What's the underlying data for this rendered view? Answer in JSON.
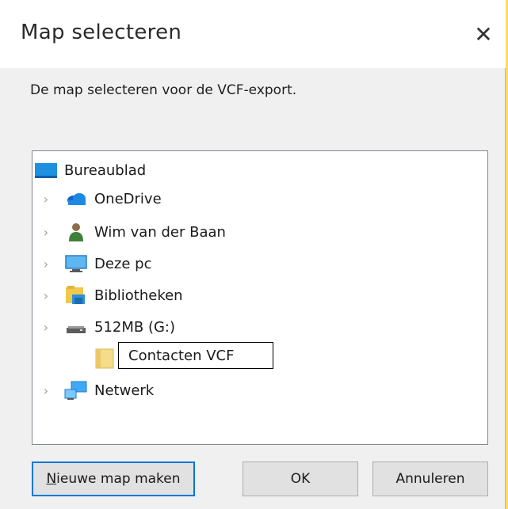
{
  "dialog": {
    "title": "Map selecteren",
    "close_glyph": "✕",
    "description": "De map selecteren voor de VCF-export."
  },
  "tree": {
    "items": [
      {
        "label": "Bureaublad",
        "icon": "desktop-icon",
        "expandable": false
      },
      {
        "label": "OneDrive",
        "icon": "onedrive-cloud-icon",
        "expandable": true
      },
      {
        "label": "Wim van der Baan",
        "icon": "user-icon",
        "expandable": true
      },
      {
        "label": "Deze pc",
        "icon": "this-pc-icon",
        "expandable": true
      },
      {
        "label": "Bibliotheken",
        "icon": "libraries-icon",
        "expandable": true
      },
      {
        "label": "512MB (G:)",
        "icon": "drive-icon",
        "expandable": true
      },
      {
        "label": "Netwerk",
        "icon": "network-icon",
        "expandable": true
      }
    ],
    "new_folder": {
      "icon": "folder-icon",
      "rename_value": "Contacten VCF"
    },
    "chevron_glyph": "›"
  },
  "buttons": {
    "new_folder_mnemonic": "N",
    "new_folder_rest": "ieuwe map maken",
    "ok": "OK",
    "cancel": "Annuleren"
  },
  "colors": {
    "accent": "#0078d7",
    "dialog_bg": "#f0f0f0",
    "window_edge": "#fbd96b"
  }
}
